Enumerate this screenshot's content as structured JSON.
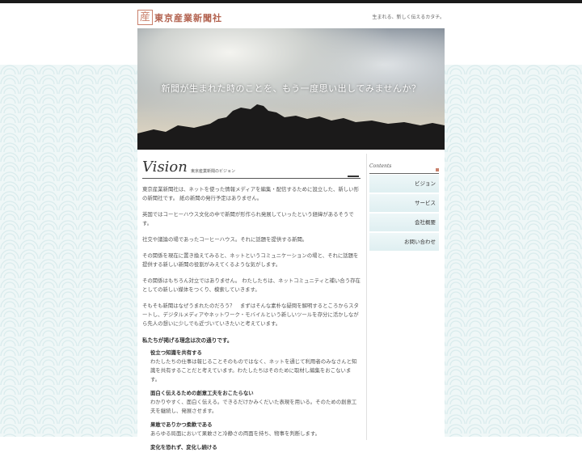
{
  "header": {
    "logo_mark": "産",
    "logo_text": "東京産業新聞社",
    "tagline": "生まれる、新しく伝えるカタチ。"
  },
  "hero": {
    "title": "新聞が生まれた時のことを、もう一度思い出してみませんか？"
  },
  "vision": {
    "heading": "Vision",
    "subheading": "東京産業新聞のビジョン",
    "paragraphs": [
      "東京産業新聞社は、ネットを使った情報メディアを編集・配信するために設立した、新しい形の新聞社です。 紙の新聞の発行予定はありません。",
      "英国ではコーヒーハウス文化の中で新聞が形作られ発展していったという経緯があるそうです。",
      "社交や議論の場であったコーヒーハウス。それに話題を提供する新聞。",
      "その関係を現在に置き換えてみると、ネットというコミュニケーションの場と、それに話題を提供する新しい新聞の役割がみえてくるような気がします。",
      "その関係はもちろん対立ではありません。 わたしたちは、ネットコミュニティと補い合う存在としての新しい媒体をつくり、模索していきます。",
      "そもそも新聞はなぜうまれたのだろう？　まずはそんな素朴な疑問を解明するところからスタートし、デジタルメディアやネットワーク・モバイルという新しいツールを存分に活かしながら先人の想いに少しでも近づいていきたいと考えています。"
    ],
    "principles_title": "私たちが掲げる理念は次の通りです。",
    "principles": [
      {
        "title": "役立つ知識を共有する",
        "body": "わたしたちの仕事は報じることそのものではなく、ネットを通じて利用者のみなさんと知識を共有することだと考えています。わたしたちはそのために取材し編集をおこないます。"
      },
      {
        "title": "面白く伝えるための創意工夫をおこたらない",
        "body": "わかりやすく、面白く伝える。できるだけかみくだいた表現を用いる。そのための創意工夫を継続し、発展させます。"
      },
      {
        "title": "果敢でありかつ柔軟である",
        "body": "あらゆる局面において果敢さと冷静さの両面を持ち、物事を判断します。"
      },
      {
        "title": "変化を恐れず、変化し続ける",
        "body": ""
      }
    ]
  },
  "sidebar": {
    "heading": "Contents",
    "items": [
      "ビジョン",
      "サービス",
      "会社概要",
      "お問い合わせ"
    ]
  },
  "colors": {
    "accent": "#c9806b",
    "nav_bg": "#e4f1f3"
  }
}
